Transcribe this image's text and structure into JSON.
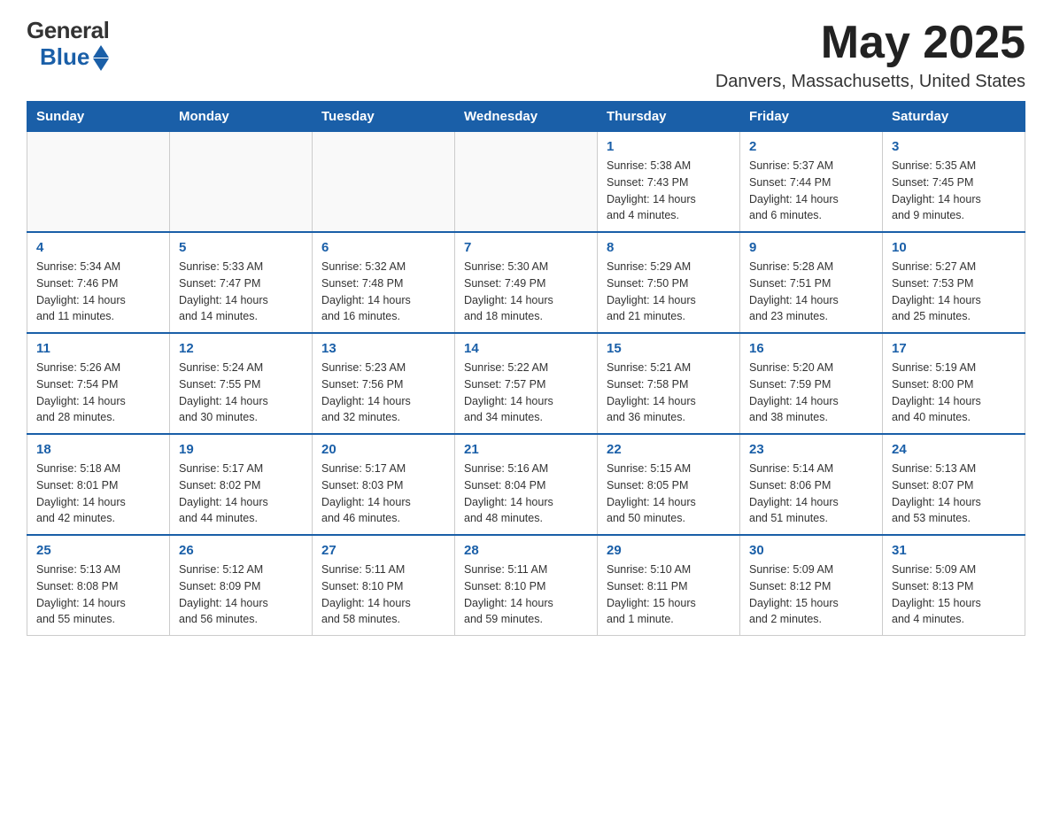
{
  "header": {
    "logo_general": "General",
    "logo_blue": "Blue",
    "month_year": "May 2025",
    "location": "Danvers, Massachusetts, United States"
  },
  "weekdays": [
    "Sunday",
    "Monday",
    "Tuesday",
    "Wednesday",
    "Thursday",
    "Friday",
    "Saturday"
  ],
  "weeks": [
    [
      {
        "day": "",
        "info": ""
      },
      {
        "day": "",
        "info": ""
      },
      {
        "day": "",
        "info": ""
      },
      {
        "day": "",
        "info": ""
      },
      {
        "day": "1",
        "info": "Sunrise: 5:38 AM\nSunset: 7:43 PM\nDaylight: 14 hours\nand 4 minutes."
      },
      {
        "day": "2",
        "info": "Sunrise: 5:37 AM\nSunset: 7:44 PM\nDaylight: 14 hours\nand 6 minutes."
      },
      {
        "day": "3",
        "info": "Sunrise: 5:35 AM\nSunset: 7:45 PM\nDaylight: 14 hours\nand 9 minutes."
      }
    ],
    [
      {
        "day": "4",
        "info": "Sunrise: 5:34 AM\nSunset: 7:46 PM\nDaylight: 14 hours\nand 11 minutes."
      },
      {
        "day": "5",
        "info": "Sunrise: 5:33 AM\nSunset: 7:47 PM\nDaylight: 14 hours\nand 14 minutes."
      },
      {
        "day": "6",
        "info": "Sunrise: 5:32 AM\nSunset: 7:48 PM\nDaylight: 14 hours\nand 16 minutes."
      },
      {
        "day": "7",
        "info": "Sunrise: 5:30 AM\nSunset: 7:49 PM\nDaylight: 14 hours\nand 18 minutes."
      },
      {
        "day": "8",
        "info": "Sunrise: 5:29 AM\nSunset: 7:50 PM\nDaylight: 14 hours\nand 21 minutes."
      },
      {
        "day": "9",
        "info": "Sunrise: 5:28 AM\nSunset: 7:51 PM\nDaylight: 14 hours\nand 23 minutes."
      },
      {
        "day": "10",
        "info": "Sunrise: 5:27 AM\nSunset: 7:53 PM\nDaylight: 14 hours\nand 25 minutes."
      }
    ],
    [
      {
        "day": "11",
        "info": "Sunrise: 5:26 AM\nSunset: 7:54 PM\nDaylight: 14 hours\nand 28 minutes."
      },
      {
        "day": "12",
        "info": "Sunrise: 5:24 AM\nSunset: 7:55 PM\nDaylight: 14 hours\nand 30 minutes."
      },
      {
        "day": "13",
        "info": "Sunrise: 5:23 AM\nSunset: 7:56 PM\nDaylight: 14 hours\nand 32 minutes."
      },
      {
        "day": "14",
        "info": "Sunrise: 5:22 AM\nSunset: 7:57 PM\nDaylight: 14 hours\nand 34 minutes."
      },
      {
        "day": "15",
        "info": "Sunrise: 5:21 AM\nSunset: 7:58 PM\nDaylight: 14 hours\nand 36 minutes."
      },
      {
        "day": "16",
        "info": "Sunrise: 5:20 AM\nSunset: 7:59 PM\nDaylight: 14 hours\nand 38 minutes."
      },
      {
        "day": "17",
        "info": "Sunrise: 5:19 AM\nSunset: 8:00 PM\nDaylight: 14 hours\nand 40 minutes."
      }
    ],
    [
      {
        "day": "18",
        "info": "Sunrise: 5:18 AM\nSunset: 8:01 PM\nDaylight: 14 hours\nand 42 minutes."
      },
      {
        "day": "19",
        "info": "Sunrise: 5:17 AM\nSunset: 8:02 PM\nDaylight: 14 hours\nand 44 minutes."
      },
      {
        "day": "20",
        "info": "Sunrise: 5:17 AM\nSunset: 8:03 PM\nDaylight: 14 hours\nand 46 minutes."
      },
      {
        "day": "21",
        "info": "Sunrise: 5:16 AM\nSunset: 8:04 PM\nDaylight: 14 hours\nand 48 minutes."
      },
      {
        "day": "22",
        "info": "Sunrise: 5:15 AM\nSunset: 8:05 PM\nDaylight: 14 hours\nand 50 minutes."
      },
      {
        "day": "23",
        "info": "Sunrise: 5:14 AM\nSunset: 8:06 PM\nDaylight: 14 hours\nand 51 minutes."
      },
      {
        "day": "24",
        "info": "Sunrise: 5:13 AM\nSunset: 8:07 PM\nDaylight: 14 hours\nand 53 minutes."
      }
    ],
    [
      {
        "day": "25",
        "info": "Sunrise: 5:13 AM\nSunset: 8:08 PM\nDaylight: 14 hours\nand 55 minutes."
      },
      {
        "day": "26",
        "info": "Sunrise: 5:12 AM\nSunset: 8:09 PM\nDaylight: 14 hours\nand 56 minutes."
      },
      {
        "day": "27",
        "info": "Sunrise: 5:11 AM\nSunset: 8:10 PM\nDaylight: 14 hours\nand 58 minutes."
      },
      {
        "day": "28",
        "info": "Sunrise: 5:11 AM\nSunset: 8:10 PM\nDaylight: 14 hours\nand 59 minutes."
      },
      {
        "day": "29",
        "info": "Sunrise: 5:10 AM\nSunset: 8:11 PM\nDaylight: 15 hours\nand 1 minute."
      },
      {
        "day": "30",
        "info": "Sunrise: 5:09 AM\nSunset: 8:12 PM\nDaylight: 15 hours\nand 2 minutes."
      },
      {
        "day": "31",
        "info": "Sunrise: 5:09 AM\nSunset: 8:13 PM\nDaylight: 15 hours\nand 4 minutes."
      }
    ]
  ]
}
